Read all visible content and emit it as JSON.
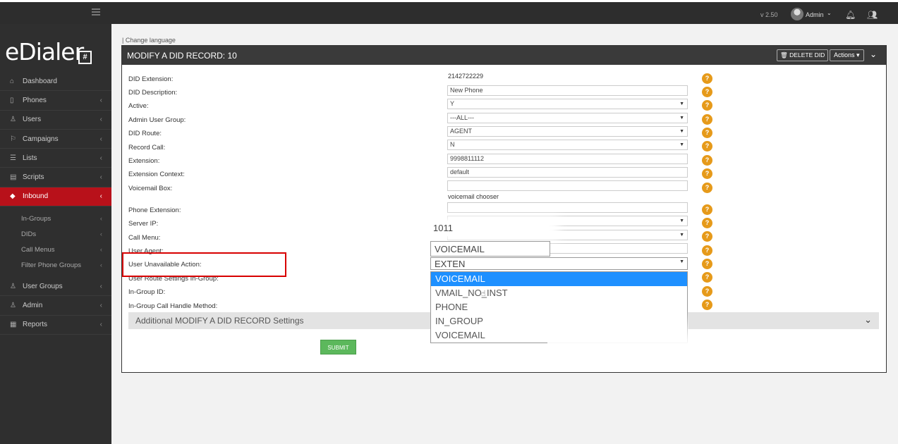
{
  "topbar": {
    "version": "v 2.50",
    "admin_label": "Admin",
    "icons": [
      "menu-icon",
      "user-avatar",
      "bell-icon",
      "users-icon"
    ]
  },
  "sidebar": {
    "logo": "eDialer",
    "logo_mark": "#",
    "items": [
      {
        "label": "Dashboard",
        "icon": "home-icon"
      },
      {
        "label": "Phones",
        "icon": "phone-icon"
      },
      {
        "label": "Users",
        "icon": "user-icon"
      },
      {
        "label": "Campaigns",
        "icon": "flag-icon"
      },
      {
        "label": "Lists",
        "icon": "list-icon"
      },
      {
        "label": "Scripts",
        "icon": "script-icon"
      },
      {
        "label": "Inbound",
        "icon": "diamond-icon"
      },
      {
        "label": "User Groups",
        "icon": "user-group-icon"
      },
      {
        "label": "Admin",
        "icon": "admin-icon"
      },
      {
        "label": "Reports",
        "icon": "report-icon"
      }
    ],
    "subitems": [
      "In-Groups",
      "DIDs",
      "Call Menus",
      "Filter Phone Groups"
    ]
  },
  "main": {
    "change_language": "| Change language",
    "panel_title": "MODIFY A DID RECORD: 10",
    "delete_label": "DELETE DID",
    "actions_label": "Actions",
    "fields": [
      {
        "label": "DID Extension:",
        "value": "2142722229"
      },
      {
        "label": "DID Description:",
        "value": "New Phone"
      },
      {
        "label": "Active:",
        "value": "Y"
      },
      {
        "label": "Admin User Group:",
        "value": "---ALL---"
      },
      {
        "label": "DID Route:",
        "value": "AGENT"
      },
      {
        "label": "Record Call:",
        "value": "N"
      },
      {
        "label": "Extension:",
        "value": "9998811112"
      },
      {
        "label": "Extension Context:",
        "value": "default"
      },
      {
        "label": "Voicemail Box:",
        "value": ""
      },
      {
        "label": "Phone Extension:",
        "value": ""
      },
      {
        "label": "Server IP:",
        "value": ""
      },
      {
        "label": "Call Menu:",
        "value": ""
      },
      {
        "label": "User Agent:",
        "value": ""
      },
      {
        "label": "User Unavailable Action:",
        "value": ""
      },
      {
        "label": "User Route Settings In-Group:",
        "value": ""
      },
      {
        "label": "In-Group ID:",
        "value": ""
      },
      {
        "label": "In-Group Call Handle Method:",
        "value": ""
      }
    ],
    "voicemail_chooser": "voicemail chooser",
    "help_glyph": "?",
    "advanced_label": "Additional MODIFY A DID RECORD Settings",
    "submit_label": "SUBMIT"
  },
  "zoom": {
    "phone_extension_value": "1011",
    "user_agent_value": "VOICEMAIL",
    "unavailable_selected": "EXTEN",
    "options": [
      "VOICEMAIL",
      "VMAIL_NO_INST",
      "PHONE",
      "IN_GROUP",
      "VOICEMAIL"
    ],
    "highlighted_index": 0
  },
  "colors": {
    "sidebar_bg": "#2f2f2f",
    "active_nav": "#b8111a",
    "help_orange": "#e69a1a",
    "submit_green": "#5cb85c",
    "highlight_blue": "#1e90ff",
    "annotation_red": "#d80000"
  }
}
